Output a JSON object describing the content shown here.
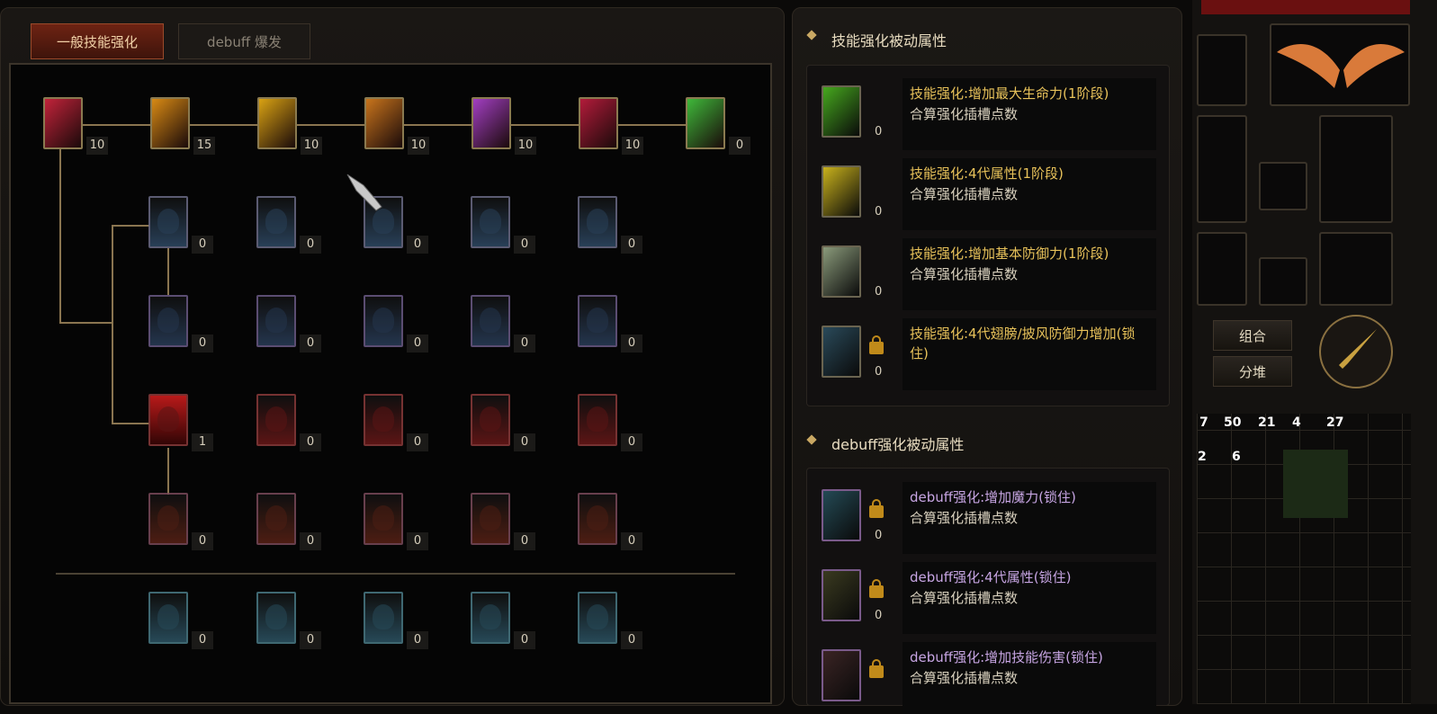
{
  "tabs": {
    "general": "一般技能强化",
    "debuff": "debuff 爆发"
  },
  "tree": {
    "top_row": [
      {
        "count": "10",
        "color": "#c2233a"
      },
      {
        "count": "15",
        "color": "#d88a14"
      },
      {
        "count": "10",
        "color": "#d9a213"
      },
      {
        "count": "10",
        "color": "#c8741c"
      },
      {
        "count": "10",
        "color": "#a23fc2"
      },
      {
        "count": "10",
        "color": "#b21b3a"
      },
      {
        "count": "0",
        "color": "#3fb83a"
      }
    ],
    "grid_rows": [
      {
        "counts": [
          "0",
          "0",
          "0",
          "0",
          "0"
        ],
        "border": "#6b6a86",
        "tint": "#2f4a66"
      },
      {
        "counts": [
          "0",
          "0",
          "0",
          "0",
          "0"
        ],
        "border": "#6b5a86",
        "tint": "#2a3e5a"
      },
      {
        "counts": [
          "1",
          "0",
          "0",
          "0",
          "0"
        ],
        "border": "#8a3a3a",
        "tint": "#6a1818"
      },
      {
        "counts": [
          "0",
          "0",
          "0",
          "0",
          "0"
        ],
        "border": "#7a4a5a",
        "tint": "#5a2216"
      },
      {
        "counts": [
          "0",
          "0",
          "0",
          "0",
          "0"
        ],
        "border": "#4a7a86",
        "tint": "#2d5566"
      }
    ]
  },
  "skill_section": {
    "title": "技能强化被动属性",
    "rows": [
      {
        "title": "技能强化:增加最大生命力(1阶段)",
        "sub": "合算强化插槽点数",
        "count": "0",
        "locked": false,
        "color": "#46a81e"
      },
      {
        "title": "技能强化:4代属性(1阶段)",
        "sub": "合算强化插槽点数",
        "count": "0",
        "locked": false,
        "color": "#c9b21c"
      },
      {
        "title": "技能强化:增加基本防御力(1阶段)",
        "sub": "合算强化插槽点数",
        "count": "0",
        "locked": false,
        "color": "#8a9a7a"
      },
      {
        "title": "技能强化:4代翅膀/披风防御力增加(锁住)",
        "sub": "",
        "count": "0",
        "locked": true,
        "color": "#2a4a5a"
      }
    ]
  },
  "debuff_section": {
    "title": "debuff强化被动属性",
    "rows": [
      {
        "title": "debuff强化:增加魔力(锁住)",
        "sub": "合算强化插槽点数",
        "count": "0",
        "locked": true,
        "color": "#244a55"
      },
      {
        "title": "debuff强化:4代属性(锁住)",
        "sub": "合算强化插槽点数",
        "count": "0",
        "locked": true,
        "color": "#3a3a20"
      },
      {
        "title": "debuff强化:增加技能伤害(锁住)",
        "sub": "合算强化插槽点数",
        "count": "",
        "locked": true,
        "color": "#3a2424"
      }
    ]
  },
  "right_panel": {
    "buttons": {
      "combine": "组合",
      "split": "分堆"
    },
    "inventory_numbers": [
      "7",
      "50",
      "21",
      "4",
      "27",
      "2",
      "6"
    ]
  }
}
